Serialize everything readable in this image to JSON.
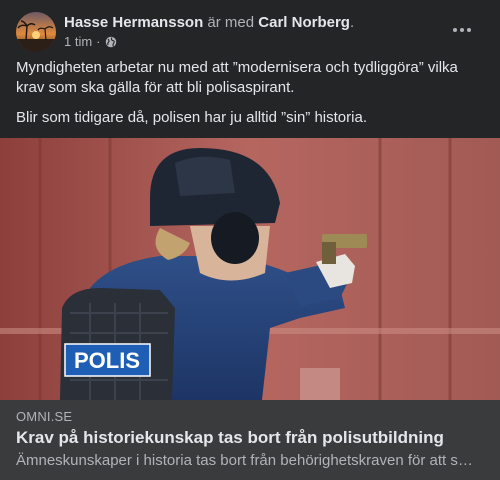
{
  "post": {
    "author": "Hasse Hermansson",
    "with_text": " är med ",
    "tagged": "Carl Norberg",
    "tagged_suffix": ".",
    "time": "1 tim",
    "separator": "·",
    "privacy_icon": "globe-icon",
    "more_icon": "more-horizontal-icon",
    "paragraphs": [
      "Myndigheten arbetar nu med att ”modernisera och tydliggöra” vilka krav som ska gälla för att bli polisaspirant.",
      "Blir som tidigare då, polisen har ju alltid ”sin” historia."
    ]
  },
  "image": {
    "vest_text": "POLIS"
  },
  "link": {
    "domain": "OMNI.SE",
    "title": "Krav på historiekunskap tas bort från polisutbildning",
    "description": "Ämneskunskaper i historia tas bort från behörighetskraven för att s…"
  },
  "colors": {
    "background": "#242526",
    "link_box": "#3a3b3c",
    "text_primary": "#e4e6eb",
    "text_secondary": "#b0b3b8"
  }
}
